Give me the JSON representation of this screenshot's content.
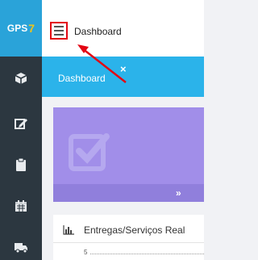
{
  "app": {
    "brand": "GPS",
    "brand_suffix": "7"
  },
  "header": {
    "breadcrumb": "Dashboard"
  },
  "tabs": [
    {
      "label": "Dashboard",
      "close": "×"
    }
  ],
  "card": {
    "more": "»"
  },
  "panel": {
    "title": "Entregas/Serviços Real",
    "tick": "5"
  },
  "sidebar": {
    "icons": [
      "cube-icon",
      "edit-icon",
      "clipboard-icon",
      "calendar-icon",
      "truck-icon"
    ]
  },
  "colors": {
    "brand": "#2aa3d9",
    "tabbar": "#2bb3ea",
    "sidebar": "#2c3740",
    "card": "#a18ee9",
    "highlight": "#e30613"
  }
}
